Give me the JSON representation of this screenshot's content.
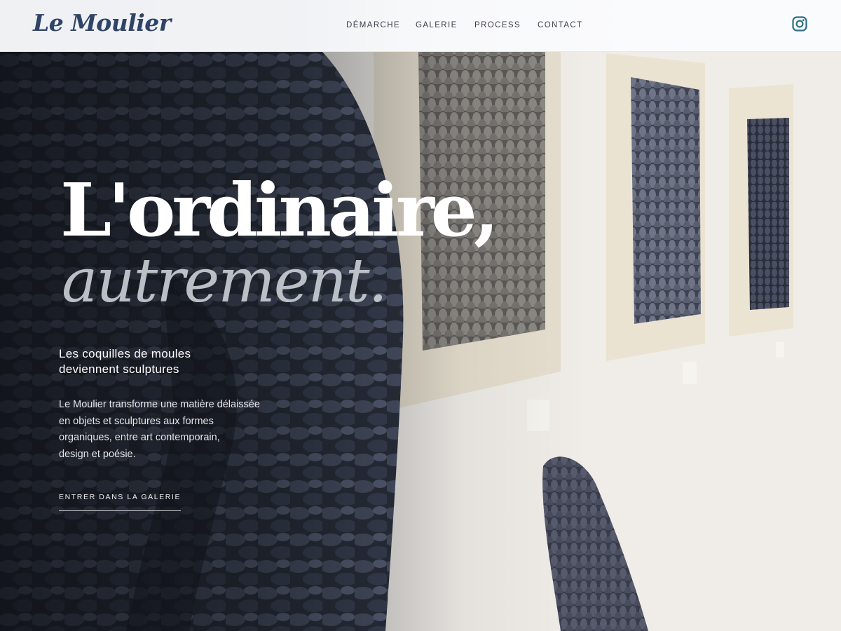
{
  "header": {
    "logo": "Le Moulier",
    "nav": [
      {
        "label": "DÉMARCHE"
      },
      {
        "label": "GALERIE"
      },
      {
        "label": "PROCESS"
      },
      {
        "label": "CONTACT"
      }
    ],
    "social_icon": "instagram-icon"
  },
  "hero": {
    "headline_line1": "L'ordinaire,",
    "headline_line2": "autrement.",
    "subtitle_lines": [
      "Les coquilles de moules",
      "deviennent sculptures"
    ],
    "description_lines": [
      "Le Moulier transforme une matière délaissée",
      "en objets et sculptures aux formes",
      "organiques, entre art contemporain,",
      "design et poésie."
    ],
    "cta_label": "ENTRER DANS LA GALERIE",
    "background_image": "photo-gallery-mussel-shell-sculptures"
  },
  "colors": {
    "brand": "#2f4466",
    "header_bg": "#fafbfd",
    "nav_text": "#3c4048",
    "headline": "#ffffff",
    "script_text": "#c8ccd3",
    "instagram": "#2d6e86"
  }
}
